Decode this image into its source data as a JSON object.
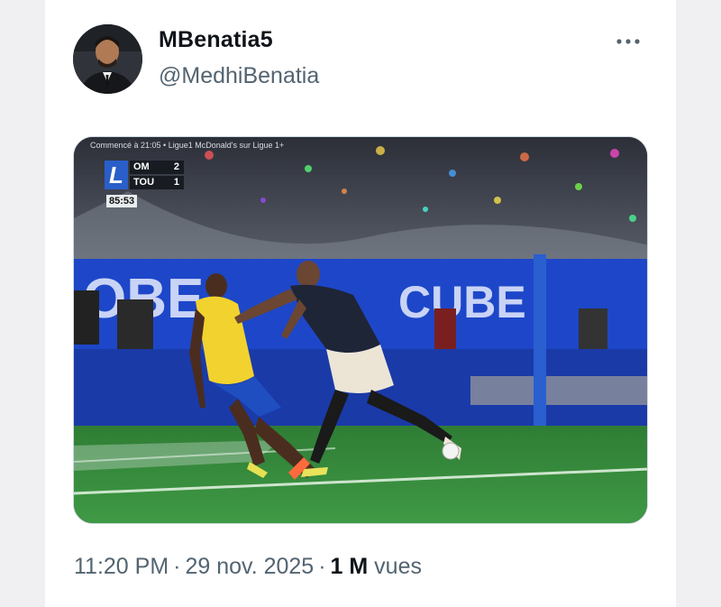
{
  "post": {
    "author": {
      "display_name": "MBenatia5",
      "handle": "@MedhiBenatia",
      "avatar_icon": "profile-photo"
    },
    "more_icon": "more-options-icon",
    "media": {
      "broadcast_label": "Commencé à 21:05 • Ligue1 McDonald's sur Ligue 1+",
      "scoreboard": {
        "logo": "L",
        "home_team": "OM",
        "home_score": "2",
        "away_team": "TOU",
        "away_score": "1",
        "clock": "85:53"
      },
      "ad_board_left": "OBE",
      "ad_board_right": "CUBE"
    },
    "timestamp": "11:20 PM",
    "separator": "·",
    "date": "29 nov. 2025",
    "views_count": "1 M",
    "views_label": "vues"
  },
  "colors": {
    "text_primary": "#0f1419",
    "text_secondary": "#536471",
    "pitch_green": "#2f8a3a",
    "ad_board_blue": "#1d47c8",
    "player_yellow": "#f2d22e",
    "player_navy": "#1e2536"
  }
}
